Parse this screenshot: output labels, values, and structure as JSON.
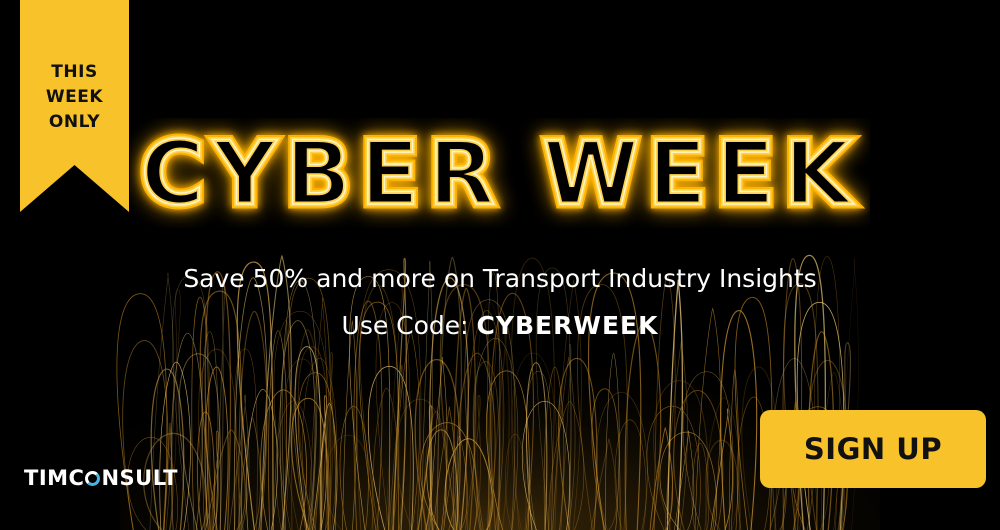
{
  "banner": {
    "ribbon_lines": [
      "THIS",
      "WEEK",
      "ONLY"
    ],
    "headline": "CYBER WEEK",
    "subline": "Save 50% and more on Transport Industry Insights",
    "code_prefix": "Use Code: ",
    "code": "CYBERWEEK",
    "logo_left": "TIMC",
    "logo_right": "NSULT",
    "signup_label": "SIGN UP"
  },
  "colors": {
    "accent": "#f8c22a",
    "neon_glow": "#ffb300",
    "neon_core": "#fff6c8",
    "background": "#000000",
    "logo_ring": "#4ab4e6"
  }
}
